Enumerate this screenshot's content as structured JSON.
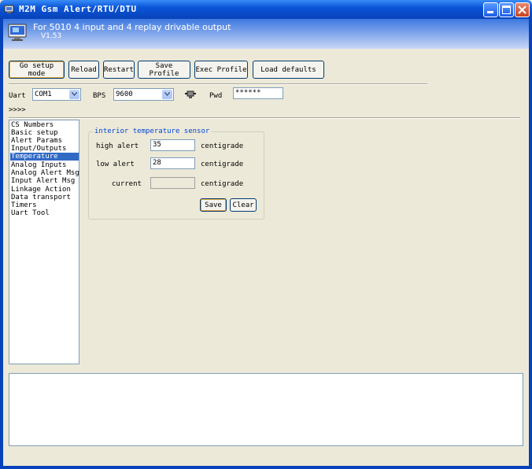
{
  "window": {
    "title": "M2M Gsm Alert/RTU/DTU"
  },
  "header": {
    "line1": "For 5010 4 input and 4 replay drivable output",
    "version": "V1.53"
  },
  "toolbar": {
    "setup_mode": "Go setup mode",
    "reload": "Reload",
    "restart": "Restart",
    "save_profile": "Save Profile",
    "exec_profile": "Exec Profile",
    "load_defaults": "Load defaults"
  },
  "conn": {
    "uart_label": "Uart",
    "uart_value": "COM1",
    "bps_label": "BPS",
    "bps_value": "9600",
    "pwd_label": "Pwd",
    "pwd_value": "******",
    "status": ">>>>"
  },
  "nav": {
    "items": [
      "CS Numbers",
      "Basic setup",
      "Alert Params",
      "Input/Outputs",
      "Temperature",
      "Analog Inputs",
      "Analog Alert Msg",
      "Input Alert Msg",
      "Linkage Action",
      "Data transport",
      "Timers",
      "Uart Tool"
    ],
    "selected": "Temperature"
  },
  "temp": {
    "group_title": "interior temperature sensor",
    "high_label": "high alert",
    "high_value": "35",
    "high_unit": "centigrade",
    "low_label": "low alert",
    "low_value": "28",
    "low_unit": "centigrade",
    "current_label": "current",
    "current_value": "",
    "current_unit": "centigrade",
    "save": "Save",
    "clear": "Clear"
  },
  "colors": {
    "titlebar": "#0a55d8",
    "selection": "#316ac5",
    "group_title": "#0046d5"
  }
}
